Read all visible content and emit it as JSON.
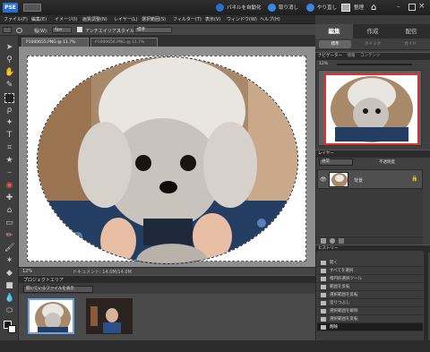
{
  "titlebar": {
    "logo": "PSE",
    "actions": [
      "パネルを自動化",
      "取り消し",
      "やり直し",
      "整理",
      "ホーム"
    ]
  },
  "menubar": [
    "ファイル(F)",
    "編集(E)",
    "イメージ(I)",
    "画質調整(N)",
    "レイヤー(L)",
    "選択範囲(S)",
    "フィルター(T)",
    "表示(V)",
    "ウィンドウ(W)",
    "ヘルプ(H)"
  ],
  "options": {
    "width_label": "幅(W):",
    "width_value": "6px",
    "antialias_label": "アンチエイリアス",
    "style_label": "スタイル:",
    "style_value": "標準"
  },
  "doc_tabs": [
    {
      "label": "P1000655.PNG @ 11.7% (RGB/8)",
      "active": true
    },
    {
      "label": "P1000656.PNG @ 11.7% (RGB/8)",
      "active": false
    }
  ],
  "statusbar": {
    "zoom": "12%",
    "doc_info": "ドキュメント: 14.0M/14.0M"
  },
  "projectbin": {
    "title": "プロジェクトエリア",
    "selector": "開いているファイルを表示",
    "count": 2,
    "selected_index": 0
  },
  "right_panel": {
    "mode_tabs": [
      "編集",
      "作成",
      "配信"
    ],
    "active_mode": 0,
    "sub_tabs": [
      "標準",
      "クイック",
      "ガイド"
    ],
    "active_sub": 0,
    "navigator": {
      "tabs": [
        "ナビゲーター",
        "情報",
        "コンテンツ"
      ],
      "zoom": "12%"
    },
    "layers": {
      "title": "レイヤー",
      "blend": "通常",
      "opacity": "不透明度",
      "layer_name": "背景"
    },
    "history": {
      "title": "ヒストリー",
      "items": [
        "開く",
        "すべてを選択",
        "楕円形選択ツール",
        "範囲を反転",
        "選択範囲を反転",
        "塗りつぶし",
        "選択範囲を解除",
        "選択範囲を反転",
        "削除"
      ],
      "selected_index": 8
    }
  },
  "colors": {
    "accent": "#2a6fd0",
    "selection": "#e03030",
    "thumb_border": "#6aa2e8"
  }
}
